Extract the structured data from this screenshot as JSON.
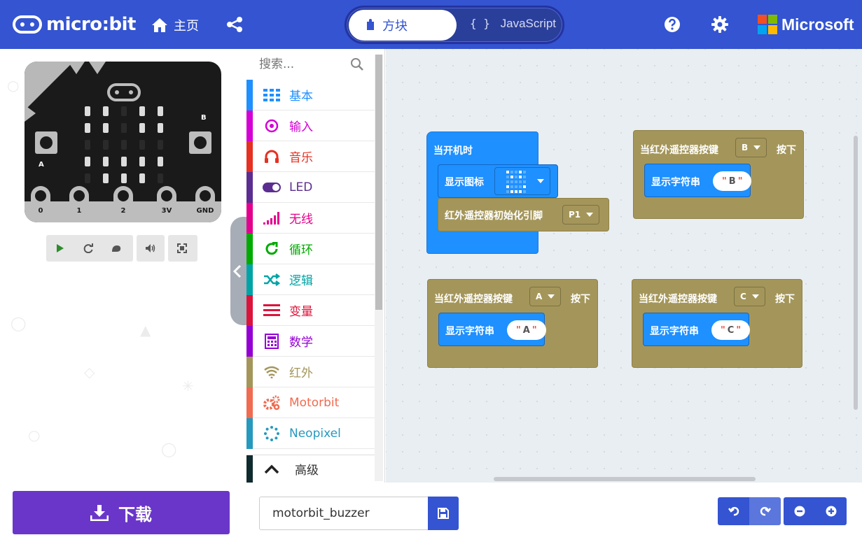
{
  "header": {
    "logo_text": "micro:bit",
    "home_label": "主页",
    "tabs": [
      {
        "label": "方块",
        "active": true
      },
      {
        "label": "JavaScript",
        "active": false
      }
    ],
    "js_braces": "{ }",
    "brand": "Microsoft",
    "colors": {
      "header_bg": "#3454d1"
    }
  },
  "simulator": {
    "pin_labels": [
      "0",
      "1",
      "2",
      "3V",
      "GND"
    ],
    "button_a": "A",
    "button_b": "B",
    "controls": [
      "play-icon",
      "restart-icon",
      "slowmo-icon",
      "mute-icon",
      "fullscreen-icon"
    ]
  },
  "toolbox": {
    "search_placeholder": "搜索...",
    "categories": [
      {
        "label": "基本",
        "color": "#1e90ff"
      },
      {
        "label": "输入",
        "color": "#d400d4"
      },
      {
        "label": "音乐",
        "color": "#e63022"
      },
      {
        "label": "LED",
        "color": "#5c2d91"
      },
      {
        "label": "无线",
        "color": "#e3008c"
      },
      {
        "label": "循环",
        "color": "#00aa00"
      },
      {
        "label": "逻辑",
        "color": "#00a4a6"
      },
      {
        "label": "变量",
        "color": "#dc143c"
      },
      {
        "label": "数学",
        "color": "#9400d3"
      },
      {
        "label": "红外",
        "color": "#a4965a"
      },
      {
        "label": "Motorbit",
        "color": "#f06b50"
      },
      {
        "label": "Neopixel",
        "color": "#2699bf"
      }
    ],
    "advanced_label": "高级"
  },
  "workspace": {
    "on_start": {
      "title": "当开机时",
      "show_icon": "显示图标",
      "ir_init": "红外遥控器初始化引脚",
      "ir_pin": "P1"
    },
    "handlers": [
      {
        "prefix": "当红外遥控器按键",
        "key": "B",
        "suffix": "按下",
        "action": "显示字符串",
        "value": "B"
      },
      {
        "prefix": "当红外遥控器按键",
        "key": "A",
        "suffix": "按下",
        "action": "显示字符串",
        "value": "A"
      },
      {
        "prefix": "当红外遥控器按键",
        "key": "C",
        "suffix": "按下",
        "action": "显示字符串",
        "value": "C"
      }
    ]
  },
  "footer": {
    "download_label": "下载",
    "project_name": "motorbit_buzzer",
    "download_color": "#6a36c9"
  }
}
